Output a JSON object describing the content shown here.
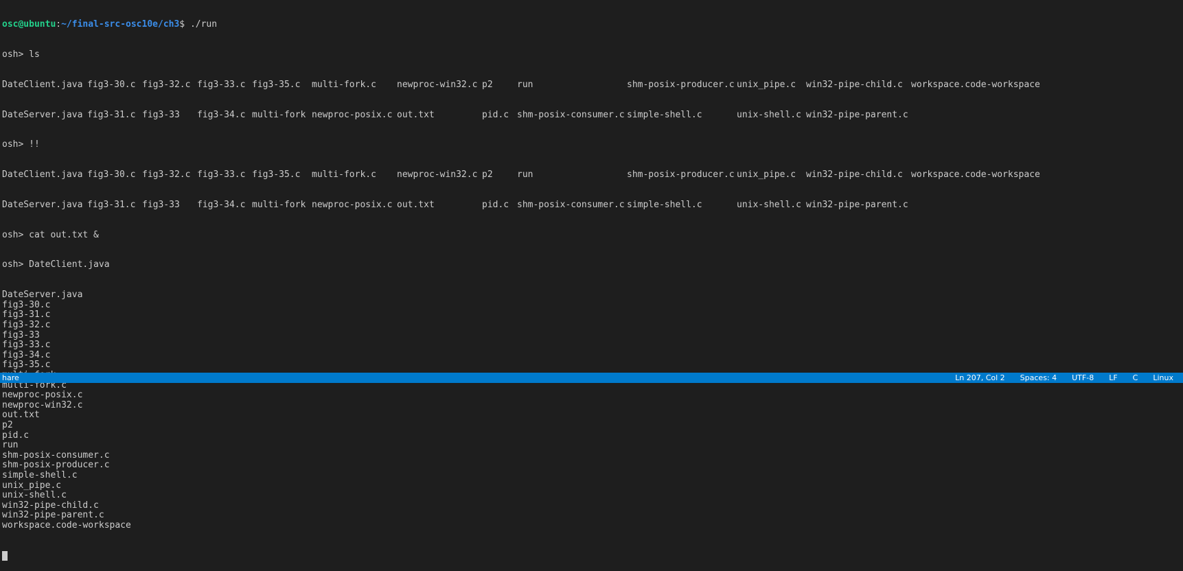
{
  "prompt": {
    "user": "osc@ubuntu",
    "sep": ":",
    "path": "~/final-src-osc10e/ch3",
    "symbol": "$ ",
    "command": "./run"
  },
  "ls_row1": [
    "DateClient.java",
    "fig3-30.c",
    "fig3-32.c",
    "fig3-33.c",
    "fig3-35.c",
    "multi-fork.c",
    "newproc-win32.c",
    "p2",
    "run",
    "shm-posix-producer.c",
    "unix_pipe.c",
    "win32-pipe-child.c",
    "workspace.code-workspace"
  ],
  "ls_row2": [
    "DateServer.java",
    "fig3-31.c",
    "fig3-33",
    "fig3-34.c",
    "multi-fork",
    "newproc-posix.c",
    "out.txt",
    "pid.c",
    "shm-posix-consumer.c",
    "simple-shell.c",
    "unix-shell.c",
    "win32-pipe-parent.c"
  ],
  "osh_ls": "osh> ls",
  "osh_bang": "osh> !!",
  "osh_cat": "osh> cat out.txt &",
  "osh_date": "osh> DateClient.java",
  "cat_output": [
    "DateServer.java",
    "fig3-30.c",
    "fig3-31.c",
    "fig3-32.c",
    "fig3-33",
    "fig3-33.c",
    "fig3-34.c",
    "fig3-35.c",
    "multi-fork",
    "multi-fork.c",
    "newproc-posix.c",
    "newproc-win32.c",
    "out.txt",
    "p2",
    "pid.c",
    "run",
    "shm-posix-consumer.c",
    "shm-posix-producer.c",
    "simple-shell.c",
    "unix_pipe.c",
    "unix-shell.c",
    "win32-pipe-child.c",
    "win32-pipe-parent.c",
    "workspace.code-workspace"
  ],
  "statusbar": {
    "left": "hare",
    "position": "Ln 207, Col 2",
    "spaces": "Spaces: 4",
    "encoding": "UTF-8",
    "eol": "LF",
    "language": "C",
    "platform": "Linux"
  },
  "colors": {
    "background": "#1e1e1e",
    "text": "#cccccc",
    "user": "#23d18b",
    "path": "#3b8eea",
    "statusbar": "#007acc"
  }
}
